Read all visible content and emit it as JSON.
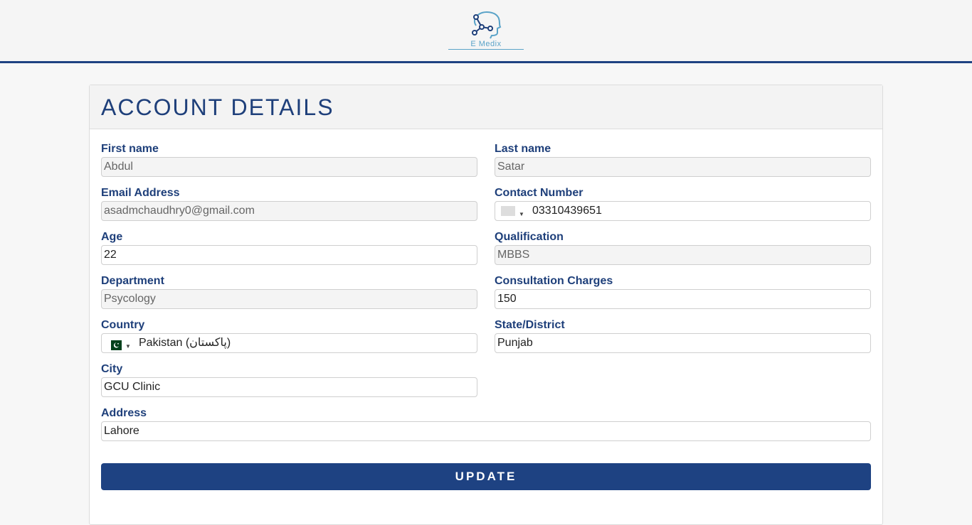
{
  "header": {
    "logo_text": "E Medix",
    "logo_icon": "head-network-icon",
    "accent_color": "#1e4282"
  },
  "card": {
    "title": "ACCOUNT DETAILS"
  },
  "fields": {
    "first_name": {
      "label": "First name",
      "value": "Abdul",
      "readonly": true
    },
    "last_name": {
      "label": "Last name",
      "value": "Satar",
      "readonly": true
    },
    "email": {
      "label": "Email Address",
      "value": "asadmchaudhry0@gmail.com",
      "readonly": true
    },
    "contact": {
      "label": "Contact Number",
      "value": "03310439651",
      "readonly": false
    },
    "age": {
      "label": "Age",
      "value": "22",
      "readonly": false
    },
    "qualification": {
      "label": "Qualification",
      "value": "MBBS",
      "readonly": true
    },
    "department": {
      "label": "Department",
      "value": "Psycology",
      "readonly": true
    },
    "charges": {
      "label": "Consultation Charges",
      "value": "150",
      "readonly": false
    },
    "country": {
      "label": "Country",
      "value": "Pakistan (‫پاکستان‬‎)",
      "flag_icon": "pakistan-flag-icon",
      "readonly": false
    },
    "state": {
      "label": "State/District",
      "value": "Punjab",
      "readonly": false
    },
    "city": {
      "label": "City",
      "value": "GCU Clinic",
      "readonly": false
    },
    "address": {
      "label": "Address",
      "value": "Lahore",
      "readonly": false
    }
  },
  "actions": {
    "update_label": "UPDATE"
  }
}
